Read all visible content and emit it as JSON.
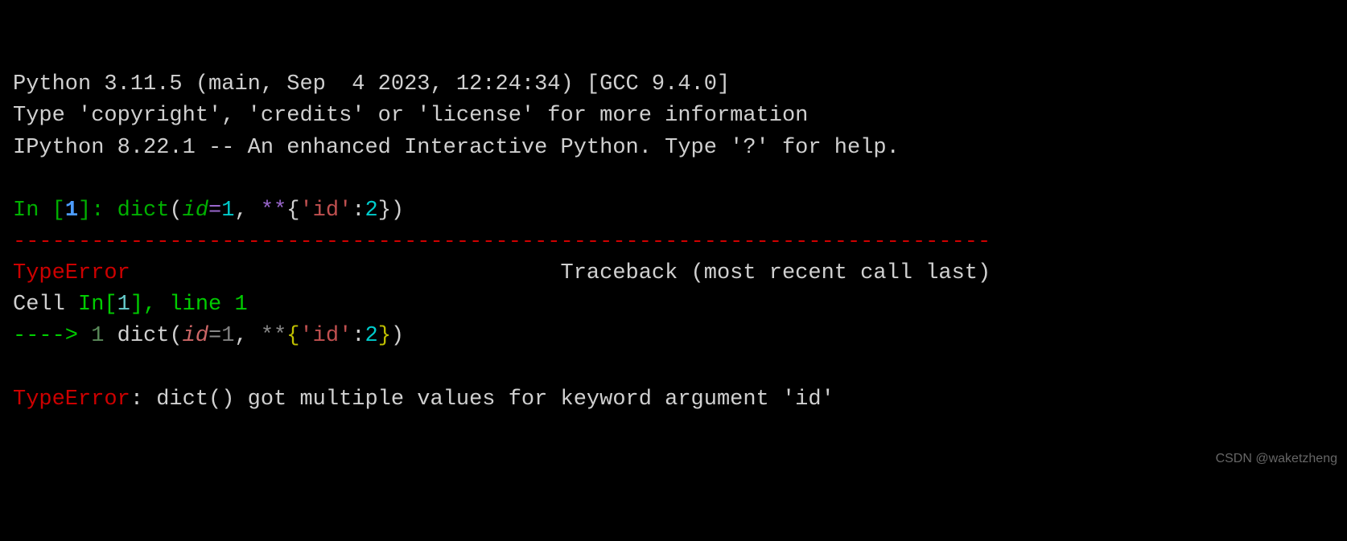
{
  "banner": {
    "line1": "Python 3.11.5 (main, Sep  4 2023, 12:24:34) [GCC 9.4.0]",
    "line2": "Type 'copyright', 'credits' or 'license' for more information",
    "line3": "IPython 8.22.1 -- An enhanced Interactive Python. Type '?' for help."
  },
  "input": {
    "prompt_prefix": "In [",
    "prompt_num": "1",
    "prompt_suffix": "]: ",
    "func": "dict",
    "open_paren": "(",
    "kwarg": "id",
    "eq": "=",
    "val1": "1",
    "comma": ", ",
    "stars": "**",
    "open_curly": "{",
    "key_q1": "'",
    "key": "id",
    "key_q2": "'",
    "colon": ":",
    "val2": "2",
    "close_curly": "}",
    "close_paren": ")"
  },
  "separator": "---------------------------------------------------------------------------",
  "error": {
    "name": "TypeError",
    "traceback_label": "Traceback (most recent call last)"
  },
  "cell": {
    "prefix": "Cell ",
    "in": "In[",
    "num": "1",
    "close": "]",
    "suffix": ", line 1"
  },
  "tb_line": {
    "arrow": "----> ",
    "lineno": "1",
    "space": " ",
    "func": "dict",
    "open_paren": "(",
    "kwarg": "id",
    "eq": "=",
    "val1": "1",
    "comma": ", ",
    "stars": "**",
    "open_curly": "{",
    "key_q1": "'",
    "key": "id",
    "key_q2": "'",
    "colon": ":",
    "val2": "2",
    "close_curly": "}",
    "close_paren": ")"
  },
  "final_error": {
    "name": "TypeError",
    "msg": ": dict() got multiple values for keyword argument 'id'"
  },
  "watermark": "CSDN @waketzheng"
}
